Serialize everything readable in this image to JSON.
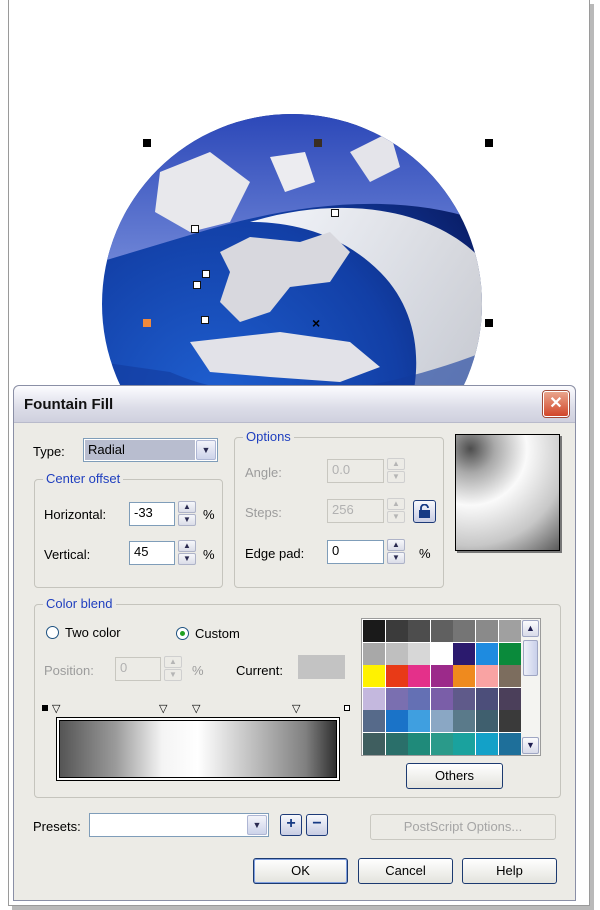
{
  "dialog": {
    "title": "Fountain Fill",
    "close_glyph": "✕",
    "type": {
      "label": "Type:",
      "value": "Radial"
    },
    "center_offset": {
      "title": "Center offset",
      "horizontal": {
        "label": "Horizontal:",
        "value": "-33",
        "unit": "%"
      },
      "vertical": {
        "label": "Vertical:",
        "value": "45",
        "unit": "%"
      }
    },
    "options": {
      "title": "Options",
      "angle": {
        "label": "Angle:",
        "value": "0.0"
      },
      "steps": {
        "label": "Steps:",
        "value": "256"
      },
      "edge_pad": {
        "label": "Edge pad:",
        "value": "0",
        "unit": "%"
      }
    },
    "color_blend": {
      "title": "Color blend",
      "two_color": "Two color",
      "custom": "Custom",
      "selected": "custom",
      "position": {
        "label": "Position:",
        "value": "0",
        "unit": "%"
      },
      "current_label": "Current:",
      "current_color": "#c3c3c3",
      "others_label": "Others",
      "palette": [
        "#1a1a1a",
        "#3b3b3b",
        "#4d4d4d",
        "#606060",
        "#757575",
        "#8a8a8a",
        "#a0a0a0",
        "#a8a8a8",
        "#bfbfbf",
        "#d7d7d7",
        "#ffffff",
        "#2b1a6e",
        "#1e8be0",
        "#0a8a3b",
        "#fff200",
        "#e83a17",
        "#e4308a",
        "#9c2a8a",
        "#ef8a1e",
        "#f9a3a3",
        "#7c6d5e",
        "#c4b8de",
        "#7a6fb0",
        "#6470b4",
        "#7a5ea8",
        "#5f5a8a",
        "#4c4e7a",
        "#4b3f5a",
        "#566a8a",
        "#1a73c8",
        "#3f9fe0",
        "#8aa7c4",
        "#5a7a8a",
        "#3f5f6e",
        "#3a3a3a",
        "#3f5e5f",
        "#2a6f6a",
        "#1f8a7a",
        "#2a9a8a",
        "#1aa29e",
        "#13a1c8",
        "#1e6f9a"
      ]
    },
    "presets": {
      "label": "Presets:",
      "value": "",
      "add": "+",
      "remove": "−"
    },
    "postscript_label": "PostScript Options...",
    "ok_label": "OK",
    "cancel_label": "Cancel",
    "help_label": "Help"
  }
}
